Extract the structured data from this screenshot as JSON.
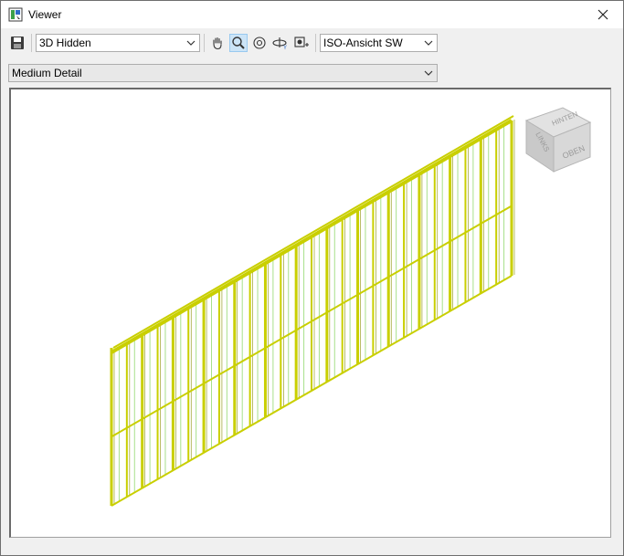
{
  "window": {
    "title": "Viewer",
    "close_glyph": "✕"
  },
  "toolbar": {
    "save_icon": "save-icon",
    "visual_style": "3D Hidden",
    "view": "ISO-Ansicht SW",
    "tools": [
      "pan-icon",
      "zoom-icon",
      "orbit-icon",
      "rotate-icon",
      "camera-icon"
    ],
    "active_tool": "zoom-icon"
  },
  "detail": {
    "level": "Medium Detail"
  },
  "viewcube": {
    "face_top": "OBEN",
    "face_left": "LINKS",
    "face_back": "HINTEN"
  },
  "colors": {
    "wall": "#c9cf00",
    "glass": "#a8e08a",
    "accent": "#cce4f7"
  }
}
